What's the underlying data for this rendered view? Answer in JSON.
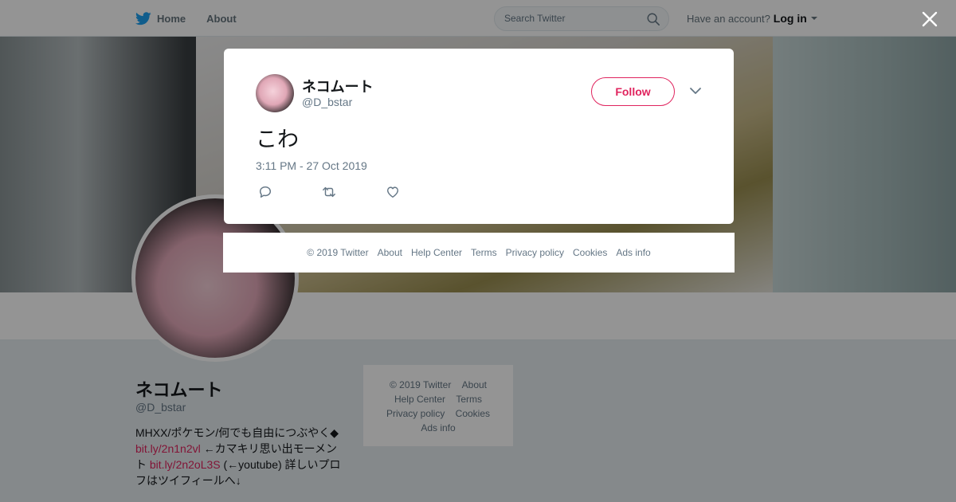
{
  "topnav": {
    "home_label": "Home",
    "about_label": "About",
    "search_placeholder": "Search Twitter",
    "have_account": "Have an account?",
    "login_label": "Log in"
  },
  "profile": {
    "name": "ネコムート",
    "handle": "@D_bstar",
    "bio_text1": "MHXX/ポケモン/何でも自由につぶやく◆",
    "bio_link1": "bit.ly/2n1n2vl",
    "bio_text2": " ←カマキリ思い出モーメント ",
    "bio_link2": "bit.ly/2n2oL3S",
    "bio_text3": " (←youtube) 詳しいプロフはツイフィールへ↓"
  },
  "side_footer": {
    "items": [
      "© 2019 Twitter",
      "About",
      "Help Center",
      "Terms",
      "Privacy policy",
      "Cookies",
      "Ads info"
    ]
  },
  "tweet": {
    "author_name": "ネコムート",
    "author_handle": "@D_bstar",
    "follow_label": "Follow",
    "text": "こわ",
    "timestamp": "3:11 PM - 27 Oct 2019"
  },
  "modal_footer": {
    "items": [
      "© 2019 Twitter",
      "About",
      "Help Center",
      "Terms",
      "Privacy policy",
      "Cookies",
      "Ads info"
    ]
  },
  "colors": {
    "accent": "#e0245e",
    "twitter_blue": "#1da1f2",
    "muted_text": "#657786"
  }
}
